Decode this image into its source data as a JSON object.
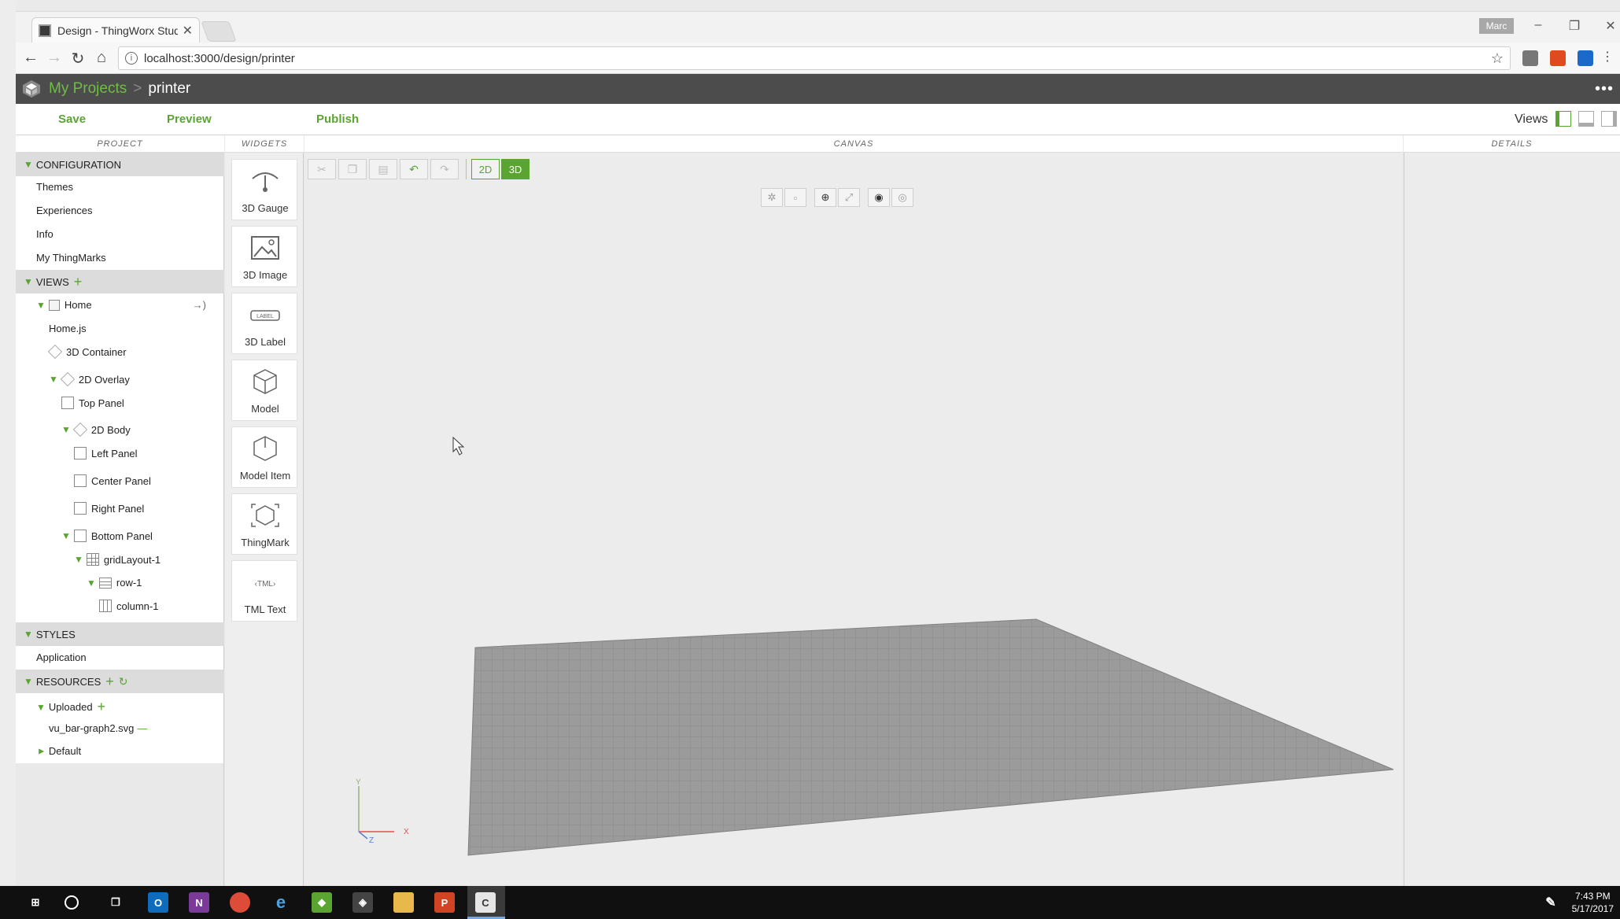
{
  "browser": {
    "tab_title": "Design - ThingWorx Studio",
    "user_badge": "Marc",
    "url": "localhost:3000/design/printer",
    "window_min": "–",
    "window_restore": "❐",
    "window_close": "✕",
    "back": "←",
    "forward": "→",
    "reload": "↻",
    "home": "⌂",
    "star": "☆"
  },
  "app": {
    "breadcrumb_root": "My Projects",
    "breadcrumb_sep": ">",
    "project_name": "printer",
    "more": "•••"
  },
  "toolbar": {
    "save": "Save",
    "preview": "Preview",
    "publish": "Publish",
    "views": "Views"
  },
  "columns": {
    "project": "PROJECT",
    "widgets": "WIDGETS",
    "canvas": "CANVAS",
    "details": "DETAILS"
  },
  "project": {
    "configuration": {
      "label": "CONFIGURATION",
      "items": [
        "Themes",
        "Experiences",
        "Info",
        "My ThingMarks"
      ]
    },
    "views": {
      "label": "VIEWS",
      "tree": {
        "home": "Home",
        "home_js": "Home.js",
        "container_3d": "3D Container",
        "overlay_2d": "2D Overlay",
        "top_panel": "Top Panel",
        "body_2d": "2D Body",
        "left_panel": "Left Panel",
        "center_panel": "Center Panel",
        "right_panel": "Right Panel",
        "bottom_panel": "Bottom Panel",
        "grid_layout": "gridLayout-1",
        "row": "row-1",
        "column": "column-1"
      }
    },
    "styles": {
      "label": "STYLES",
      "items": [
        "Application"
      ]
    },
    "resources": {
      "label": "RESOURCES",
      "uploaded": "Uploaded",
      "uploaded_file": "vu_bar-graph2.svg",
      "default": "Default"
    }
  },
  "widgets": [
    {
      "label": "3D Gauge",
      "icon": "gauge-icon"
    },
    {
      "label": "3D Image",
      "icon": "image-icon"
    },
    {
      "label": "3D Label",
      "icon": "label-icon"
    },
    {
      "label": "Model",
      "icon": "model-icon"
    },
    {
      "label": "Model Item",
      "icon": "model-item-icon"
    },
    {
      "label": "ThingMark",
      "icon": "thingmark-icon"
    },
    {
      "label": "TML Text",
      "icon": "tml-text-icon"
    }
  ],
  "widget_icon_text": {
    "label": "LABEL",
    "tml": "‹TML›"
  },
  "canvas": {
    "mode_2d": "2D",
    "mode_3d": "3D",
    "active_mode": "3D",
    "axis_x": "X",
    "axis_y": "Y",
    "axis_z": "Z"
  },
  "taskbar": {
    "time": "7:43 PM",
    "date": "5/17/2017"
  },
  "colors": {
    "accent_green": "#5aa531",
    "header_dark": "#4c4c4c",
    "grid_floor": "#9b9b9b"
  }
}
